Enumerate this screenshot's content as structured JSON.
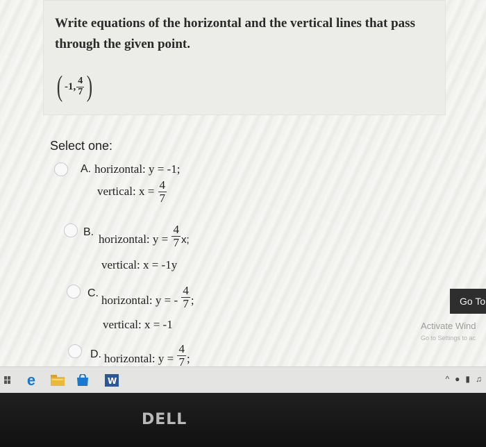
{
  "question": {
    "text": "Write equations of the horizontal and the vertical lines that pass through the given point.",
    "point": {
      "x": "-1,",
      "y_num": "4",
      "y_den": "7"
    }
  },
  "select_label": "Select one:",
  "options": [
    {
      "letter": "A.",
      "horizontal": "horizontal: y = -1;",
      "vertical_prefix": "vertical: x = ",
      "vertical_num": "4",
      "vertical_den": "7"
    },
    {
      "letter": "B.",
      "horizontal_prefix": "horizontal: y = ",
      "horizontal_num": "4",
      "horizontal_den": "7",
      "horizontal_suffix": "x;",
      "vertical": "vertical: x = -1y"
    },
    {
      "letter": "C.",
      "horizontal_prefix": "horizontal: y = - ",
      "horizontal_num": "4",
      "horizontal_den": "7",
      "horizontal_suffix": ";",
      "vertical": "vertical: x = -1"
    },
    {
      "letter": "D.",
      "horizontal_prefix": "horizontal: y = ",
      "horizontal_num": "4",
      "horizontal_den": "7",
      "horizontal_suffix": ";"
    }
  ],
  "goto_label": "Go To",
  "activate": {
    "title": "Activate Wind",
    "subtitle": "Go to Settings to ac"
  },
  "bezel": {
    "logo": "DELL"
  },
  "colors": {
    "screen_bg": "#f1f1ef",
    "question_bg": "#ecece9",
    "taskbar_bg": "#e4e4e2",
    "bezel": "#1a1a1a"
  }
}
